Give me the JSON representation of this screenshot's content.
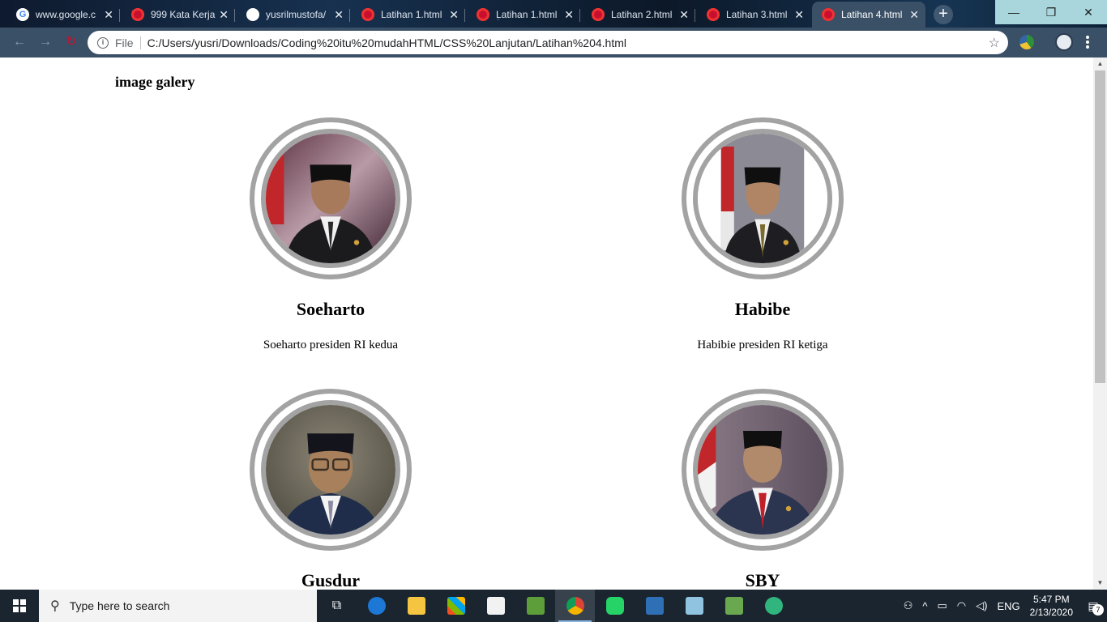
{
  "browser": {
    "tabs": [
      {
        "label": "www.google.c",
        "icon": "google-icon"
      },
      {
        "label": "999 Kata Kerja",
        "icon": "red-site-icon"
      },
      {
        "label": "yusrilmustofa/",
        "icon": "github-icon"
      },
      {
        "label": "Latihan 1.html",
        "icon": "red-site-icon"
      },
      {
        "label": "Latihan 1.html",
        "icon": "red-site-icon"
      },
      {
        "label": "Latihan 2.html",
        "icon": "red-site-icon"
      },
      {
        "label": "Latihan 3.html",
        "icon": "red-site-icon"
      },
      {
        "label": "Latihan 4.html",
        "icon": "red-site-icon",
        "active": true
      }
    ],
    "new_tab": "+",
    "address": {
      "scheme": "File",
      "url": "C:/Users/yusri/Downloads/Coding%20itu%20mudahHTML/CSS%20Lanjutan/Latihan%204.html"
    }
  },
  "page": {
    "title": "image galery",
    "cards": [
      {
        "name": "Soeharto",
        "description": "Soeharto presiden RI kedua"
      },
      {
        "name": "Habibe",
        "description": "Habibie presiden RI ketiga"
      },
      {
        "name": "Gusdur",
        "description": ""
      },
      {
        "name": "SBY",
        "description": ""
      }
    ],
    "ring_color": "#a3a3a3"
  },
  "taskbar": {
    "search_placeholder": "Type here to search",
    "language": "ENG",
    "time": "5:47 PM",
    "date": "2/13/2020",
    "notification_count": "7"
  }
}
